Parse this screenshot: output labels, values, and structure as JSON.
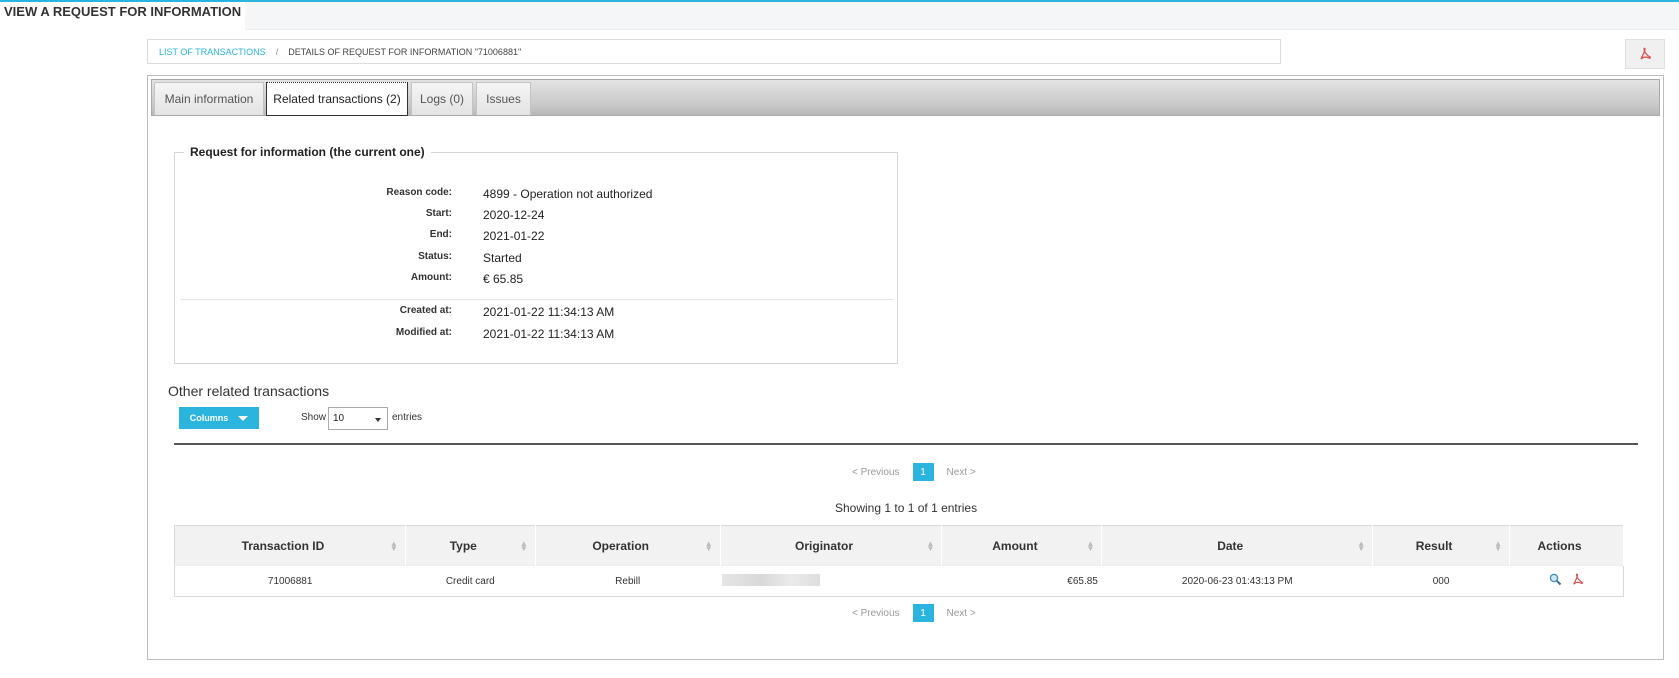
{
  "page": {
    "title": "VIEW A REQUEST FOR INFORMATION"
  },
  "breadcrumb": {
    "link": "LIST OF TRANSACTIONS",
    "separator": "/",
    "current": "DETAILS OF REQUEST FOR INFORMATION \"71006881\""
  },
  "tabs": [
    {
      "label": "Main information"
    },
    {
      "label": "Related transactions (2)",
      "active": true
    },
    {
      "label": "Logs (0)"
    },
    {
      "label": "Issues"
    }
  ],
  "rfi": {
    "legend": "Request for information (the current one)",
    "fields": [
      {
        "label": "Reason code:",
        "value": "4899 - Operation not authorized"
      },
      {
        "label": "Start:",
        "value": "2020-12-24"
      },
      {
        "label": "End:",
        "value": "2021-01-22"
      },
      {
        "label": "Status:",
        "value": "Started"
      },
      {
        "label": "Amount:",
        "value": "€ 65.85"
      },
      {
        "label": "Created at:",
        "value": "2021-01-22 11:34:13 AM"
      },
      {
        "label": "Modified at:",
        "value": "2021-01-22 11:34:13 AM"
      }
    ]
  },
  "related": {
    "heading": "Other related transactions",
    "columns_button": "Columns",
    "show_label": "Show",
    "entries_value": "10",
    "entries_label": "entries",
    "showing": "Showing 1 to 1 of 1 entries",
    "pager": {
      "prev": "< Previous",
      "page": "1",
      "next": "Next >"
    },
    "table": {
      "headers": [
        "Transaction ID",
        "Type",
        "Operation",
        "Originator",
        "Amount",
        "Date",
        "Result",
        "Actions"
      ],
      "rows": [
        {
          "id": "71006881",
          "type": "Credit card",
          "operation": "Rebill",
          "originator": "",
          "amount": "€65.85",
          "date": "2020-06-23 01:43:13 PM",
          "result": "000"
        }
      ]
    }
  },
  "colors": {
    "accent": "#2bb4de",
    "pdf_red": "#d9534f"
  },
  "icons": {
    "pdf": "pdf-icon",
    "view": "magnifier-icon"
  }
}
